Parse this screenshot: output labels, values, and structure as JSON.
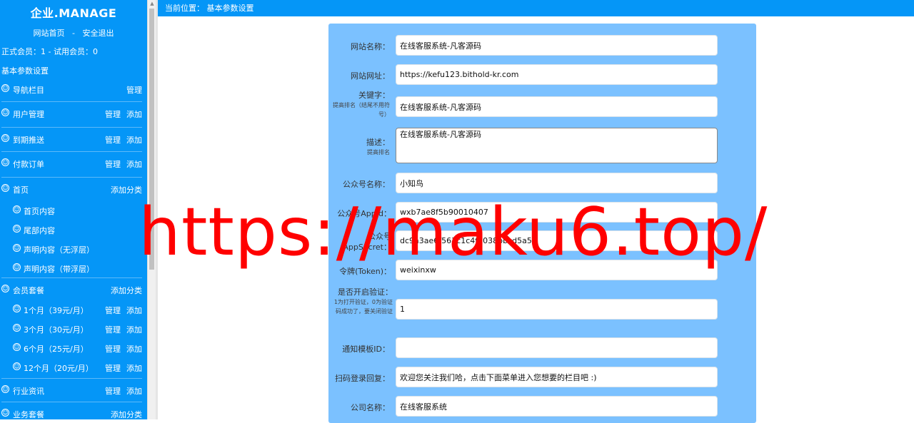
{
  "sidebar": {
    "logo": "企业.MANAGE",
    "home_link": "网站首页",
    "separator": "-",
    "logout_link": "安全退出",
    "members_text": "正式会员：1  -  试用会员：0",
    "settings_title": "基本参数设置",
    "items": [
      {
        "label": "导航栏目",
        "actions": [
          "管理"
        ]
      },
      {
        "label": "用户管理",
        "actions": [
          "管理",
          "添加"
        ]
      },
      {
        "label": "到期推送",
        "actions": [
          "管理",
          "添加"
        ]
      },
      {
        "label": "付款订单",
        "actions": [
          "管理",
          "添加"
        ]
      },
      {
        "label": "首页",
        "actions": [
          "添加分类"
        ],
        "children": [
          {
            "label": "首页内容"
          },
          {
            "label": "尾部内容"
          },
          {
            "label": "声明内容（无浮层）"
          },
          {
            "label": "声明内容（带浮层）"
          }
        ]
      },
      {
        "label": "会员套餐",
        "actions": [
          "添加分类"
        ],
        "children": [
          {
            "label": "1个月（39元/月）",
            "actions": [
              "管理",
              "添加"
            ]
          },
          {
            "label": "3个月（30元/月）",
            "actions": [
              "管理",
              "添加"
            ]
          },
          {
            "label": "6个月（25元/月）",
            "actions": [
              "管理",
              "添加"
            ]
          },
          {
            "label": "12个月（20元/月）",
            "actions": [
              "管理",
              "添加"
            ]
          }
        ]
      },
      {
        "label": "行业资讯",
        "actions": [
          "管理",
          "添加"
        ]
      },
      {
        "label": "业务套餐",
        "actions": [
          "添加分类"
        ]
      }
    ],
    "icon": "smiley-icon"
  },
  "topbar": {
    "breadcrumb": "当前位置：  基本参数设置"
  },
  "form": {
    "site_name": {
      "label": "网站名称：",
      "value": "在线客服系统-凡客源码"
    },
    "site_url": {
      "label": "网站网址：",
      "value": "https://kefu123.bithold-kr.com"
    },
    "keywords": {
      "label": "关键字：",
      "hint": "提高排名（结尾不用符号）",
      "value": "在线客服系统-凡客源码"
    },
    "description": {
      "label": "描述：",
      "hint": "提高排名",
      "value": "在线客服系统-凡客源码"
    },
    "wechat_name": {
      "label": "公众号名称：",
      "value": "小知鸟"
    },
    "appid": {
      "label": "公众号AppId：",
      "value": "wxb7ae8f5b90010407"
    },
    "appsecret": {
      "label": "公众号AppSecret：",
      "value": "dc9a3ae6f563c1c4f8038bbcd5a53"
    },
    "token": {
      "label": "令牌(Token)：",
      "value": "weixinxw"
    },
    "verify": {
      "label": "是否开启验证：",
      "hint": "1为打开验证，0为验证码成功了，要关闭验证",
      "value": "1"
    },
    "template_id": {
      "label": "通知模板ID：",
      "value": ""
    },
    "scan_reply": {
      "label": "扫码登录回复：",
      "value": "欢迎您关注我们哈，点击下面菜单进入您想要的栏目吧 :)"
    },
    "company_name": {
      "label": "公司名称：",
      "value": "在线客服系统"
    }
  },
  "watermark": "https://maku6.top/",
  "colors": {
    "sidebar": "#0596f7",
    "panel": "#7bc1ff",
    "watermark": "#ff0000"
  }
}
